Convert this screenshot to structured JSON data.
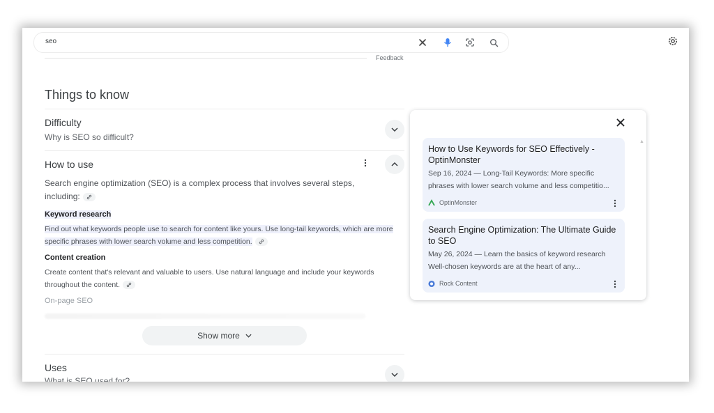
{
  "search": {
    "query": "seo",
    "icons": [
      "close-icon",
      "microphone-icon",
      "lens-icon",
      "search-icon"
    ]
  },
  "header": {
    "settings_icon": "gear-icon"
  },
  "feedback_label": "Feedback",
  "things_to_know": {
    "title": "Things to know",
    "difficulty": {
      "title": "Difficulty",
      "subtitle": "Why is SEO so difficult?"
    },
    "how_to_use": {
      "title": "How to use",
      "intro": "Search engine optimization (SEO) is a complex process that involves several steps, including:",
      "keyword_research": {
        "heading": "Keyword research",
        "text": "Find out what keywords people use to search for content like yours. Use long-tail keywords, which are more specific phrases with lower search volume and less competition."
      },
      "content_creation": {
        "heading": "Content creation",
        "text": "Create content that's relevant and valuable to users. Use natural language and include your keywords throughout the content."
      },
      "on_page": {
        "heading": "On-page SEO"
      }
    },
    "show_more": "Show more",
    "uses": {
      "title": "Uses",
      "subtitle": "What is SEO used for?"
    }
  },
  "side_panel": {
    "cards": [
      {
        "title": "How to Use Keywords for SEO Effectively - OptinMonster",
        "snippet": "Sep 16, 2024 — Long-Tail Keywords: More specific phrases with lower search volume and less competitio...",
        "source": "OptinMonster",
        "favicon": "optinmonster-favicon"
      },
      {
        "title": "Search Engine Optimization: The Ultimate Guide to SEO",
        "snippet": "May 26, 2024 — Learn the basics of keyword research Well-chosen keywords are at the heart of any...",
        "source": "Rock Content",
        "favicon": "rock-content-favicon"
      }
    ]
  },
  "colors": {
    "card_background": "#eef2fb",
    "highlight": "#eef0fb",
    "mic_blue": "#4285f4",
    "optinmonster_green": "#34a853",
    "rockcontent_blue": "#4a7bd8"
  }
}
